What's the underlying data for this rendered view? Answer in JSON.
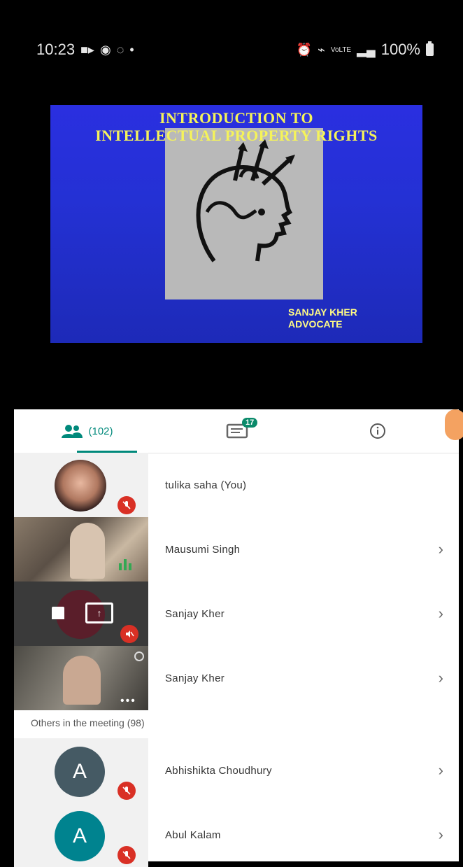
{
  "status": {
    "time": "10:23",
    "signal_label": "VoLTE",
    "battery": "100%"
  },
  "slide": {
    "title_line1": "INTRODUCTION  TO",
    "title_line2": "INTELLECTUAL PROPERTY RIGHTS",
    "author_line1": "SANJAY KHER",
    "author_line2": "ADVOCATE"
  },
  "tabs": {
    "people_count": "(102)",
    "chat_badge": "17"
  },
  "participants": [
    {
      "name": "tulika saha (You)",
      "muted": true
    },
    {
      "name": "Mausumi Singh",
      "muted": false
    },
    {
      "name": "Sanjay Kher",
      "muted": true
    },
    {
      "name": "Sanjay Kher",
      "muted": false
    }
  ],
  "others_label": "Others in the meeting (98)",
  "others": [
    {
      "initial": "A",
      "name": "Abhishikta Choudhury",
      "avatar_color": "#455a64"
    },
    {
      "initial": "A",
      "name": "Abul Kalam",
      "avatar_color": "#00838f"
    }
  ],
  "colors": {
    "accent": "#00897b",
    "mute": "#d93025"
  }
}
